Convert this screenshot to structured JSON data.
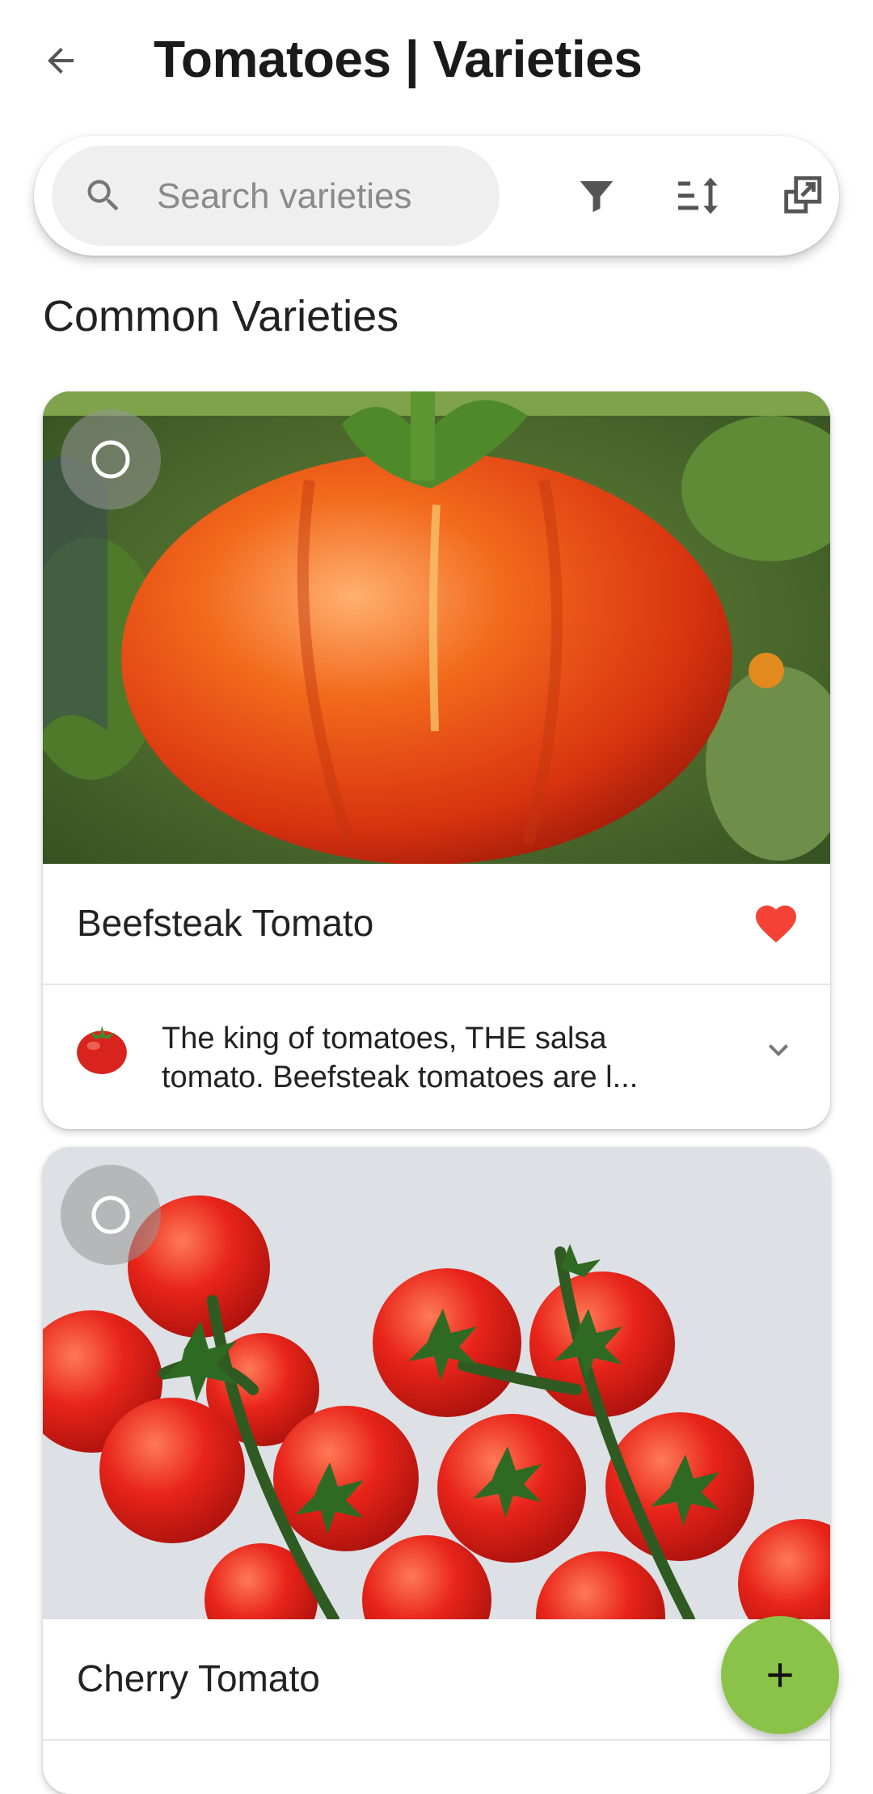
{
  "header": {
    "title": "Tomatoes | Varieties"
  },
  "search": {
    "placeholder": "Search varieties",
    "value": ""
  },
  "section": {
    "title": "Common Varieties"
  },
  "cards": [
    {
      "name": "Beefsteak Tomato",
      "favorite": true,
      "description": "The king of tomatoes, THE salsa tomato. Beefsteak tomatoes are l..."
    },
    {
      "name": "Cherry Tomato",
      "favorite": false
    }
  ],
  "colors": {
    "accent": "#8bc34a",
    "favorite": "#f44336",
    "search_bg": "#efefef"
  },
  "icons": [
    "back-arrow-icon",
    "search-icon",
    "filter-icon",
    "sort-icon",
    "open-external-icon",
    "select-circle-icon",
    "heart-icon",
    "tomato-icon",
    "chevron-down-icon",
    "plus-icon"
  ]
}
